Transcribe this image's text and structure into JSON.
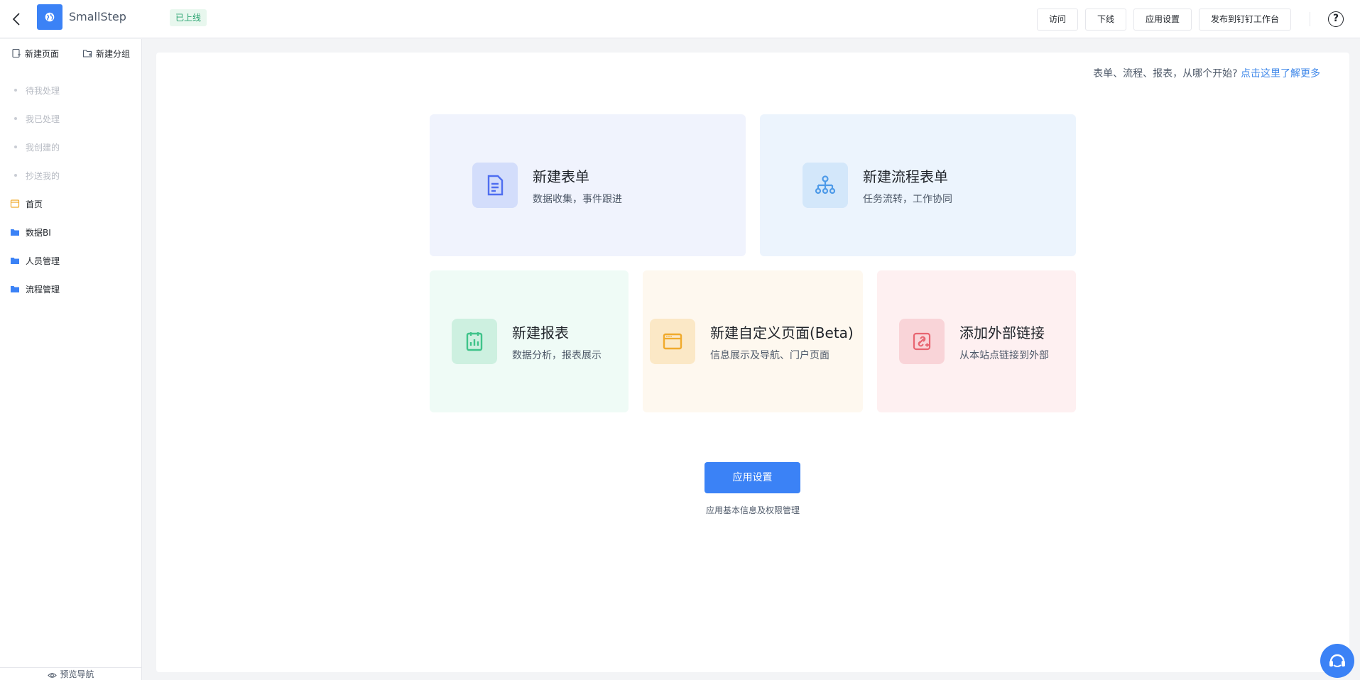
{
  "header": {
    "app_name": "SmallStep",
    "status": "已上线",
    "buttons": {
      "visit": "访问",
      "offline": "下线",
      "app_settings": "应用设置",
      "publish": "发布到钉钉工作台"
    },
    "help": "?"
  },
  "sidebar": {
    "new_page": "新建页面",
    "new_group": "新建分组",
    "dim_items": [
      {
        "label": "待我处理"
      },
      {
        "label": "我已处理"
      },
      {
        "label": "我创建的"
      },
      {
        "label": "抄送我的"
      }
    ],
    "items": [
      {
        "label": "首页",
        "icon": "calendar-icon"
      },
      {
        "label": "数据BI",
        "icon": "folder-icon"
      },
      {
        "label": "人员管理",
        "icon": "folder-icon"
      },
      {
        "label": "流程管理",
        "icon": "folder-icon"
      }
    ],
    "footer": "预览导航"
  },
  "main": {
    "hint_text": "表单、流程、报表，从哪个开始?",
    "hint_link": "点击这里了解更多",
    "cards": [
      {
        "title": "新建表单",
        "desc": "数据收集，事件跟进",
        "icon": "document-icon",
        "bg": "#f0f3fd",
        "icon_bg": "#d3ddfb",
        "icon_color": "#4f6ef0"
      },
      {
        "title": "新建流程表单",
        "desc": "任务流转，工作协同",
        "icon": "org-chart-icon",
        "bg": "#ecf4fd",
        "icon_bg": "#d3e7fa",
        "icon_color": "#4d9ae8"
      },
      {
        "title": "新建报表",
        "desc": "数据分析，报表展示",
        "icon": "report-icon",
        "bg": "#effbf6",
        "icon_bg": "#cdf0e0",
        "icon_color": "#3fc38a"
      },
      {
        "title": "新建自定义页面(Beta)",
        "desc": "信息展示及导航、门户页面",
        "icon": "window-icon",
        "bg": "#fef8ef",
        "icon_bg": "#fbe8c6",
        "icon_color": "#f0aa2c"
      },
      {
        "title": "添加外部链接",
        "desc": "从本站点链接到外部",
        "icon": "link-icon",
        "bg": "#fef0f1",
        "icon_bg": "#f9d4d8",
        "icon_color": "#e86470"
      }
    ],
    "settings_button": "应用设置",
    "settings_desc": "应用基本信息及权限管理"
  }
}
